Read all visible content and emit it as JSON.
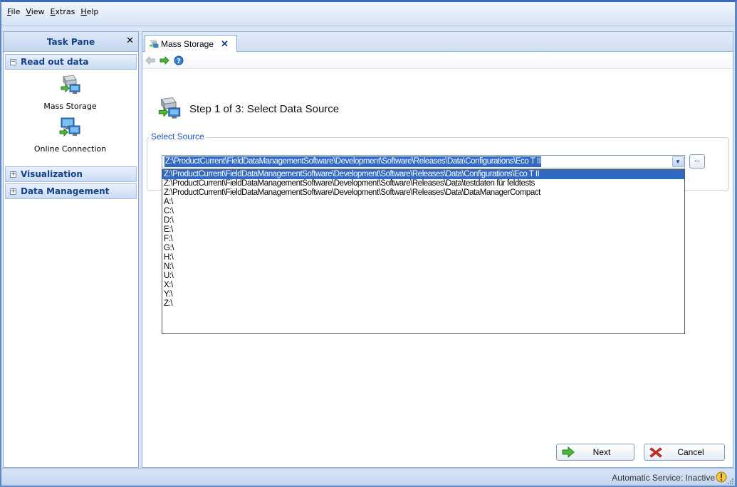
{
  "menu": {
    "items": [
      {
        "accel": "F",
        "rest": "ile"
      },
      {
        "accel": "V",
        "rest": "iew"
      },
      {
        "accel": "E",
        "rest": "xtras"
      },
      {
        "accel": "H",
        "rest": "elp"
      }
    ]
  },
  "task_pane": {
    "title": "Task Pane",
    "close_glyph": "✕",
    "groups": [
      {
        "label": "Read out data",
        "toggle": "−",
        "expanded": true
      },
      {
        "label": "Visualization",
        "toggle": "+"
      },
      {
        "label": "Data Management",
        "toggle": "+"
      }
    ],
    "entries": [
      {
        "label": "Mass Storage",
        "icon": "mass-storage-icon"
      },
      {
        "label": "Online Connection",
        "icon": "online-connection-icon"
      }
    ]
  },
  "tab": {
    "label": "Mass Storage",
    "close_glyph": "✕"
  },
  "wizard": {
    "step_title": "Step 1 of 3: Select Data Source",
    "group_label": "Select Source",
    "selected_value": "Z:\\ProductCurrent\\FieldDataManagementSoftware\\Development\\Software\\Releases\\Data\\Configurations\\Eco T II",
    "browse_label": "...",
    "options": [
      "Z:\\ProductCurrent\\FieldDataManagementSoftware\\Development\\Software\\Releases\\Data\\Configurations\\Eco T II",
      "Z:\\ProductCurrent\\FieldDataManagementSoftware\\Development\\Software\\Releases\\Data\\testdaten für feldtests",
      "Z:\\ProductCurrent\\FieldDataManagementSoftware\\Development\\Software\\Releases\\Data\\DataManagerCompact",
      "A:\\",
      "C:\\",
      "D:\\",
      "E:\\",
      "F:\\",
      "G:\\",
      "H:\\",
      "N:\\",
      "U:\\",
      "X:\\",
      "Y:\\",
      "Z:\\"
    ],
    "selected_index": 0
  },
  "buttons": {
    "next": "Next",
    "cancel": "Cancel"
  },
  "status": {
    "text": "Automatic Service: Inactive"
  },
  "colors": {
    "accent": "#316ac5",
    "frame": "#5f87c4",
    "group_text": "#15428b"
  }
}
